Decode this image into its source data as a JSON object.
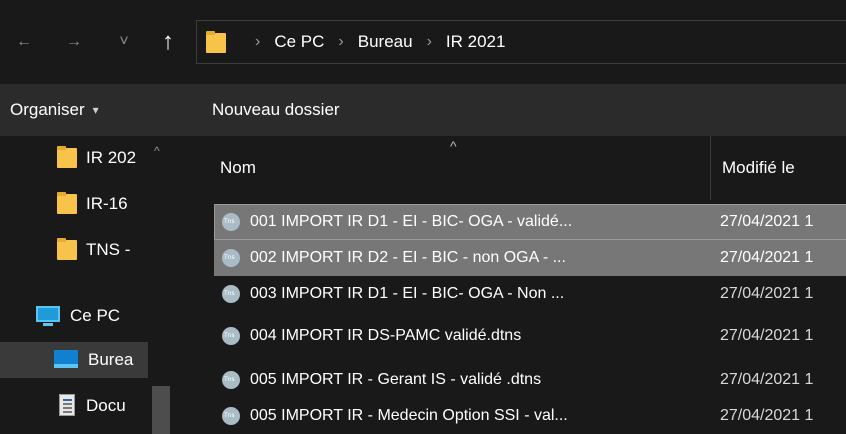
{
  "address_bar": {
    "folder_icon": "folder-icon",
    "breadcrumbs": [
      "Ce PC",
      "Bureau",
      "IR 2021"
    ],
    "separator": "›"
  },
  "nav_buttons": {
    "back": "←",
    "forward": "→",
    "recent": "˅",
    "up": "↑"
  },
  "commands": {
    "organize_label": "Organiser",
    "organize_caret": "▾",
    "new_folder_label": "Nouveau dossier"
  },
  "nav_pane": {
    "items": [
      {
        "label": "IR 202",
        "icon": "folder-icon"
      },
      {
        "label": "IR-16",
        "icon": "folder-icon"
      },
      {
        "label": "TNS -",
        "icon": "folder-icon"
      },
      {
        "label": "Ce PC",
        "icon": "monitor-icon"
      },
      {
        "label": "Burea",
        "icon": "desktop-icon"
      },
      {
        "label": "Docu",
        "icon": "documents-icon"
      }
    ],
    "scroll_up": "^"
  },
  "columns": {
    "name": "Nom",
    "modified": "Modifié le",
    "sort_indicator": "^"
  },
  "files": [
    {
      "name": "001 IMPORT IR D1 - EI - BIC- OGA - validé...",
      "date": "27/04/2021 1",
      "selected": true
    },
    {
      "name": "002 IMPORT IR D2 - EI - BIC - non OGA - ...",
      "date": "27/04/2021 1",
      "selected": true
    },
    {
      "name": "003 IMPORT IR D1 - EI - BIC- OGA - Non ...",
      "date": "27/04/2021 1",
      "selected": false
    },
    {
      "name": "004 IMPORT IR DS-PAMC validé.dtns",
      "date": "27/04/2021 1",
      "selected": false
    },
    {
      "name": "005 IMPORT IR - Gerant IS - validé .dtns",
      "date": "27/04/2021 1",
      "selected": false
    },
    {
      "name": "005 IMPORT IR - Medecin Option SSI - val...",
      "date": "27/04/2021 1",
      "selected": false
    }
  ],
  "colors": {
    "background": "#191919",
    "command_bar": "#2b2b2b",
    "selection": "#777777",
    "folder": "#f7c34a"
  }
}
